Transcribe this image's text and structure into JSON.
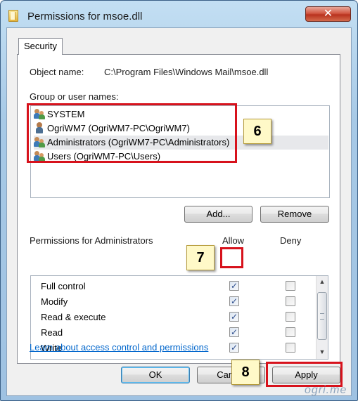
{
  "window": {
    "title": "Permissions for msoe.dll",
    "close_label": "✕"
  },
  "tab": {
    "label": "Security"
  },
  "object": {
    "label": "Object name:",
    "value": "C:\\Program Files\\Windows Mail\\msoe.dll"
  },
  "users": {
    "heading": "Group or user names:",
    "items": [
      {
        "label": "SYSTEM",
        "icon": "group-users-icon"
      },
      {
        "label": "OgriWM7 (OgriWM7-PC\\OgriWM7)",
        "icon": "user-icon"
      },
      {
        "label": "Administrators (OgriWM7-PC\\Administrators)",
        "icon": "group-users-icon",
        "selected": true
      },
      {
        "label": "Users (OgriWM7-PC\\Users)",
        "icon": "group-users-icon"
      }
    ]
  },
  "buttons": {
    "add": "Add...",
    "remove": "Remove",
    "ok": "OK",
    "cancel": "Cancel",
    "apply": "Apply"
  },
  "permissions": {
    "heading": "Permissions for Administrators",
    "allow_header": "Allow",
    "deny_header": "Deny",
    "rows": [
      {
        "name": "Full control",
        "allow": true,
        "deny": false
      },
      {
        "name": "Modify",
        "allow": true,
        "deny": false
      },
      {
        "name": "Read & execute",
        "allow": true,
        "deny": false
      },
      {
        "name": "Read",
        "allow": true,
        "deny": false
      },
      {
        "name": "Write",
        "allow": true,
        "deny": false
      }
    ]
  },
  "link": {
    "text": "Learn about access control and permissions"
  },
  "callouts": {
    "c6": "6",
    "c7": "7",
    "c8": "8"
  },
  "check_glyph": "✓",
  "watermark": "ogri.me",
  "colors": {
    "callout_border": "#d7121c",
    "callout_fill": "#fff9c8",
    "link": "#0066cc"
  }
}
